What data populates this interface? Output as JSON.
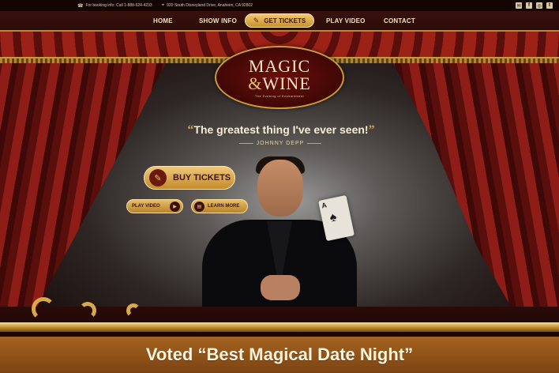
{
  "topbar": {
    "booking_info": "For booking info: Call 1-888-624-4233",
    "address": "920 South Disneyland Drive, Anaheim, CA 92802",
    "social": [
      "mail-icon",
      "facebook-icon",
      "instagram-icon",
      "twitter-icon"
    ]
  },
  "nav": {
    "home": "HOME",
    "show_info": "SHOW INFO",
    "get_tickets": "GET TICKETS",
    "play_video": "PLAY VIDEO",
    "contact": "CONTACT"
  },
  "logo": {
    "line1": "MAGIC",
    "amp": "&",
    "line2": "WINE",
    "tagline": "The Evening of Enchantment"
  },
  "hero": {
    "quote": "The greatest thing I've ever seen!",
    "attribution": "JOHNNY DEPP",
    "buy_tickets": "BUY TICKETS",
    "play_video": "PLAY VIDEO",
    "learn_more": "LEARN MORE"
  },
  "banner": {
    "text": "Voted “Best Magical Date Night”"
  },
  "colors": {
    "curtain_red": "#8e1d17",
    "gold": "#d7a84d",
    "banner_bg": "#a46320"
  }
}
